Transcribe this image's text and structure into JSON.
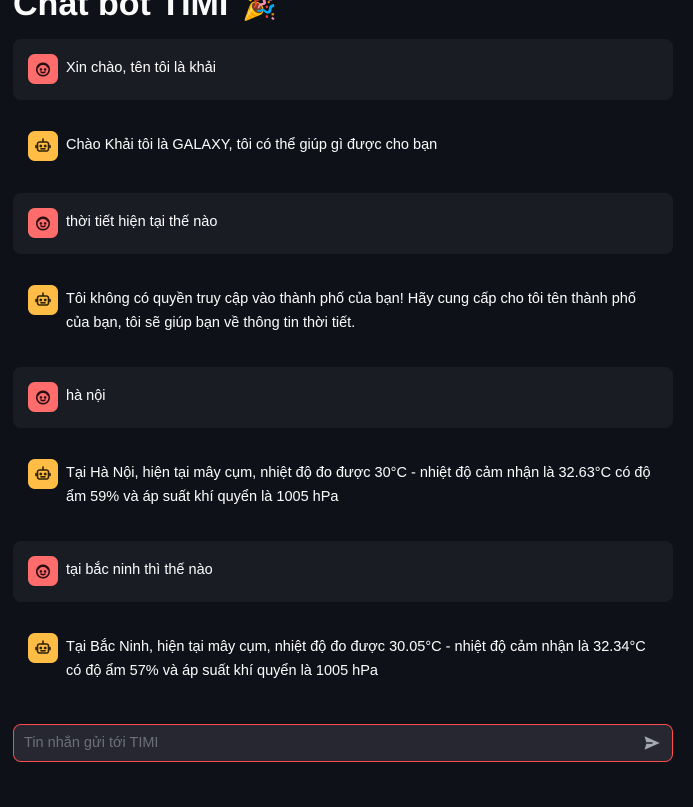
{
  "header": {
    "title": "Chat bot TIMI",
    "title_emoji": "🎉"
  },
  "messages": [
    {
      "role": "user",
      "avatar_icon": "user-face-icon",
      "text": "Xin chào, tên tôi là khải"
    },
    {
      "role": "assistant",
      "avatar_icon": "robot-icon",
      "text": "Chào Khải tôi là GALAXY, tôi có thể giúp gì được cho bạn"
    },
    {
      "role": "user",
      "avatar_icon": "user-face-icon",
      "text": "thời tiết hiện tại thế nào"
    },
    {
      "role": "assistant",
      "avatar_icon": "robot-icon",
      "text": "Tôi không có quyền truy cập vào thành phố của bạn! Hãy cung cấp cho tôi tên thành phố của bạn, tôi sẽ giúp bạn về thông tin thời tiết."
    },
    {
      "role": "user",
      "avatar_icon": "user-face-icon",
      "text": "hà nội"
    },
    {
      "role": "assistant",
      "avatar_icon": "robot-icon",
      "text": "Tại Hà Nội, hiện tại mây cụm, nhiệt độ đo được 30°C - nhiệt độ cảm nhận là 32.63°C có độ ẩm 59% và áp suất khí quyển là 1005 hPa"
    },
    {
      "role": "user",
      "avatar_icon": "user-face-icon",
      "text": "tại bắc ninh thì thế nào"
    },
    {
      "role": "assistant",
      "avatar_icon": "robot-icon",
      "text": "Tại Bắc Ninh, hiện tại mây cụm, nhiệt độ đo được 30.05°C - nhiệt độ cảm nhận là 32.34°C có độ ẩm 57% và áp suất khí quyển là 1005 hPa"
    }
  ],
  "chat_input": {
    "placeholder": "Tin nhắn gửi tới TIMI",
    "value": ""
  },
  "colors": {
    "background": "#0e1117",
    "user_bubble": "#1a1c24",
    "user_avatar": "#ff6c6c",
    "assistant_avatar": "#ffbd45",
    "input_border": "#ff4b4b",
    "input_background": "#262730"
  }
}
